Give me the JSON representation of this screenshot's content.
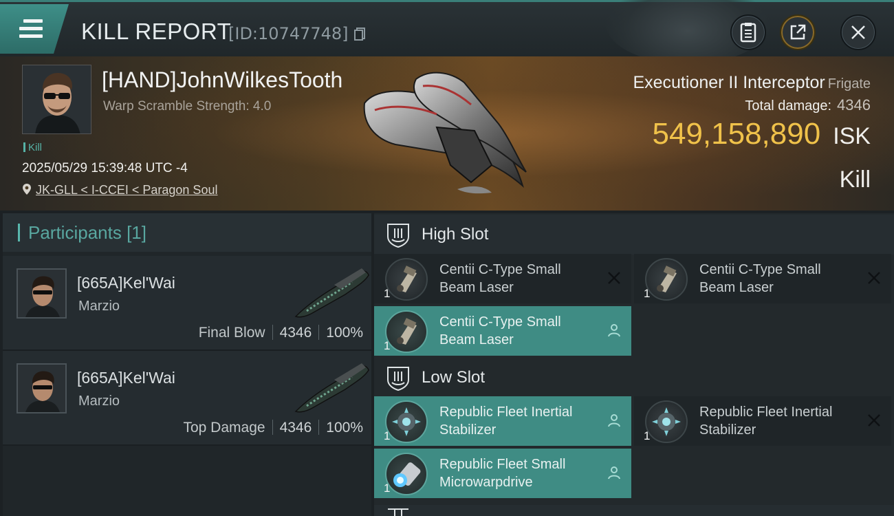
{
  "header": {
    "title": "KILL REPORT",
    "kill_id": "[ID:10747748]",
    "icons": [
      "menu-icon",
      "clipboard-icon",
      "share-icon",
      "close-icon"
    ]
  },
  "victim": {
    "name": "[HAND]JohnWilkesTooth",
    "warp_scramble": "Warp Scramble Strength: 4.0",
    "tag": "Kill",
    "datetime": "2025/05/29 15:39:48 UTC -4",
    "location": "JK-GLL < I-CCEI < Paragon Soul",
    "ship": "Executioner II Interceptor",
    "ship_class": "Frigate",
    "total_damage_label": "Total damage:",
    "total_damage": "4346",
    "isk_value": "549,158,890",
    "isk_unit": "ISK",
    "result": "Kill"
  },
  "participants": {
    "header": "Participants [1]",
    "rows": [
      {
        "name": "[665A]Kel'Wai",
        "corp": "Marzio",
        "label": "Final Blow",
        "damage": "4346",
        "percent": "100%"
      },
      {
        "name": "[665A]Kel'Wai",
        "corp": "Marzio",
        "label": "Top Damage",
        "damage": "4346",
        "percent": "100%"
      }
    ]
  },
  "slots": {
    "high": {
      "label": "High Slot",
      "modules": [
        {
          "name": "Centii C-Type Small Beam Laser",
          "qty": "1",
          "state": "destroyed"
        },
        {
          "name": "Centii C-Type Small Beam Laser",
          "qty": "1",
          "state": "destroyed"
        },
        {
          "name": "Centii C-Type Small Beam Laser",
          "qty": "1",
          "state": "dropped"
        }
      ]
    },
    "low": {
      "label": "Low Slot",
      "modules": [
        {
          "name": "Republic Fleet Inertial Stabilizer",
          "qty": "1",
          "state": "dropped"
        },
        {
          "name": "Republic Fleet Inertial Stabilizer",
          "qty": "1",
          "state": "destroyed"
        },
        {
          "name": "Republic Fleet Small Microwarpdrive",
          "qty": "1",
          "state": "dropped"
        }
      ]
    }
  },
  "colors": {
    "accent": "#3f8c84",
    "isk": "#f0c24a",
    "background": "#1c2124"
  }
}
